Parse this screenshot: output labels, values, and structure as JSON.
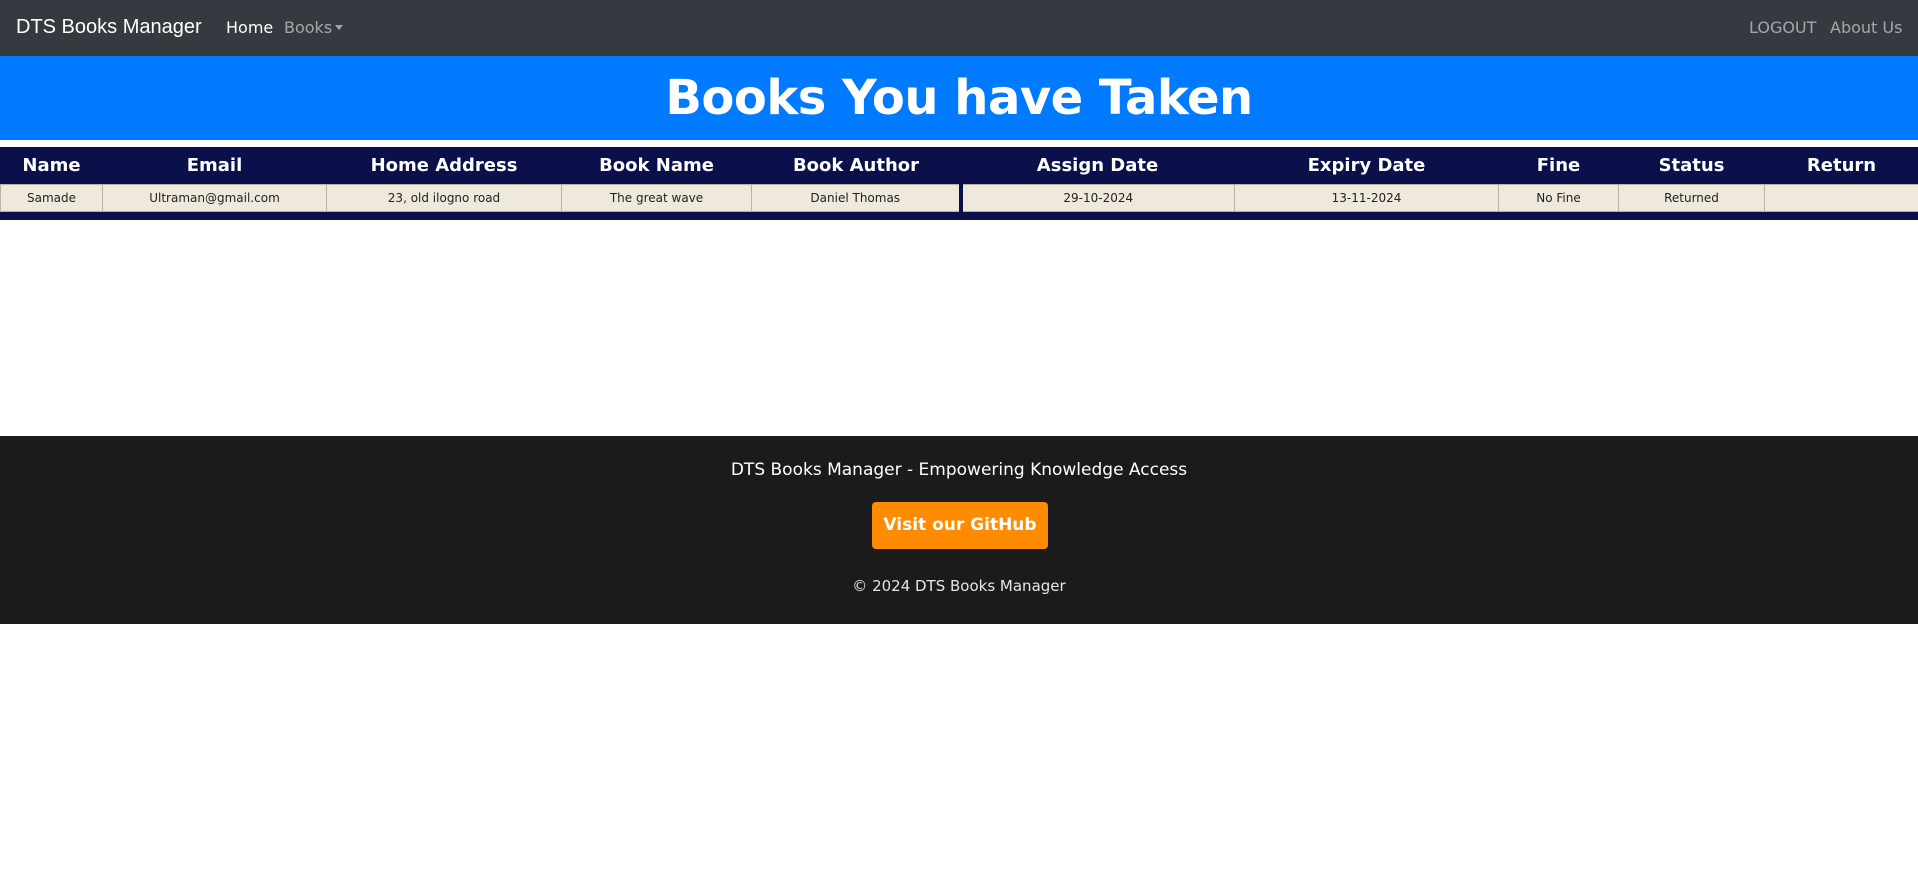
{
  "navbar": {
    "brand": "DTS Books Manager",
    "home_label": "Home",
    "books_label": "Books",
    "logout_label": "LOGOUT",
    "about_label": "About Us"
  },
  "hero": {
    "title": "Books You have Taken"
  },
  "table": {
    "headers": [
      "Name",
      "Email",
      "Home Address",
      "Book Name",
      "Book Author",
      "Assign Date",
      "Expiry Date",
      "Fine",
      "Status",
      "Return"
    ],
    "rows": [
      {
        "name": "Samade",
        "email": "Ultraman@gmail.com",
        "home_address": "23, old ilogno road",
        "book_name": "The great wave",
        "book_author": "Daniel Thomas",
        "assign_date": "29-10-2024",
        "expiry_date": "13-11-2024",
        "fine": "No Fine",
        "status": "Returned",
        "return": ""
      }
    ]
  },
  "footer": {
    "tagline": "DTS Books Manager - Empowering Knowledge Access",
    "github_button": "Visit our GitHub",
    "copyright": "© 2024 DTS Books Manager"
  },
  "colors": {
    "navbar_bg": "#343a40",
    "hero_bg": "#007bff",
    "table_header_bg": "#0b0f4a",
    "table_row_bg": "#efe8dc",
    "footer_bg": "#1b1b1c",
    "github_button_bg": "#ff8c00"
  }
}
